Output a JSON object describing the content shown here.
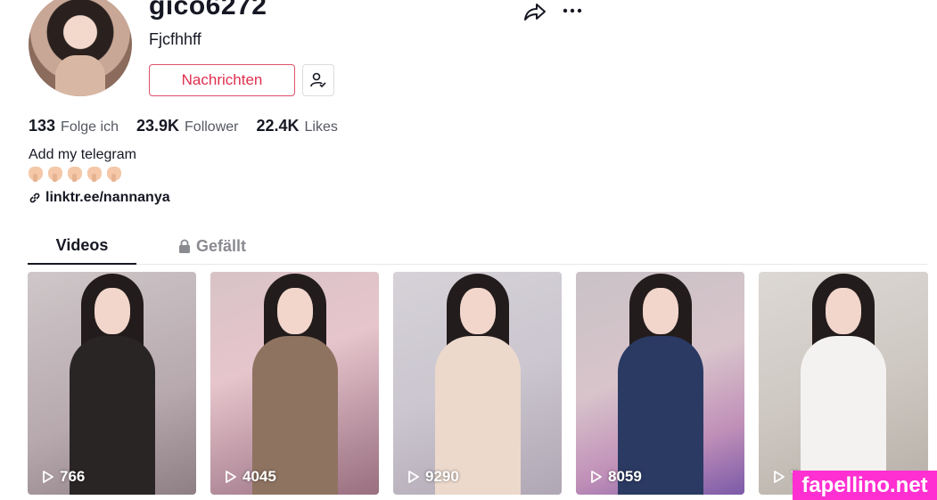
{
  "profile": {
    "username": "gico6272",
    "nickname": "Fjcfhhff",
    "message_button": "Nachrichten",
    "bio": "Add my telegram",
    "link": "linktr.ee/nannanya"
  },
  "stats": [
    {
      "value": "133",
      "label": "Folge ich"
    },
    {
      "value": "23.9K",
      "label": "Follower"
    },
    {
      "value": "22.4K",
      "label": "Likes"
    }
  ],
  "tabs": {
    "videos": "Videos",
    "liked": "Gefällt"
  },
  "videos": [
    {
      "views": "766"
    },
    {
      "views": "4045"
    },
    {
      "views": "9290"
    },
    {
      "views": "8059"
    },
    {
      "views": "7"
    }
  ],
  "watermark": "fapellino.net",
  "icons": [
    "share-icon",
    "more-icon",
    "user-check-icon",
    "link-icon",
    "lock-icon",
    "play-icon"
  ]
}
